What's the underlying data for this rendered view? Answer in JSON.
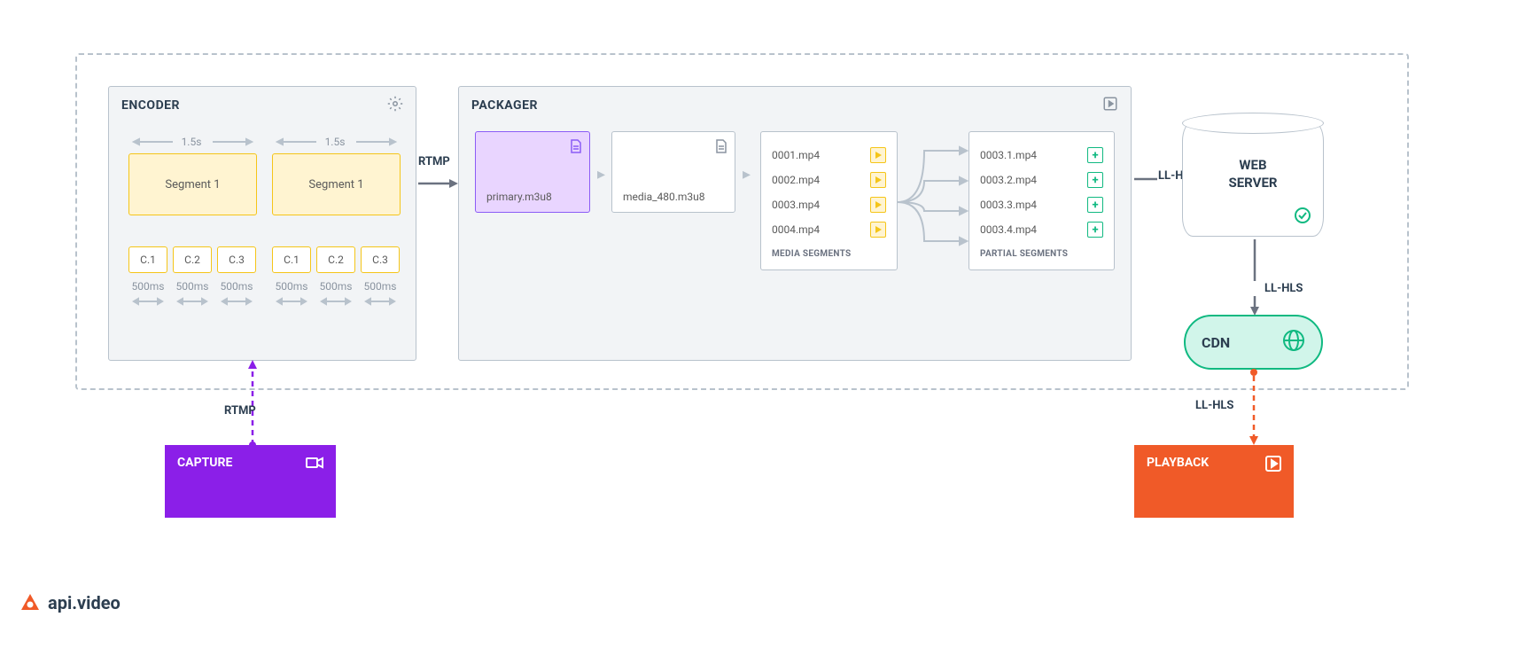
{
  "encoder": {
    "title": "ENCODER",
    "segment1": "Segment 1",
    "segment2": "Segment 1",
    "seg_time": "1.5s",
    "chunks": [
      "C.1",
      "C.2",
      "C.3"
    ],
    "chunk_time": "500ms"
  },
  "packager": {
    "title": "PACKAGER",
    "primary": "primary.m3u8",
    "media": "media_480.m3u8",
    "media_segments_label": "MEDIA SEGMENTS",
    "partial_segments_label": "PARTIAL SEGMENTS",
    "media_segments": [
      "0001.mp4",
      "0002.mp4",
      "0003.mp4",
      "0004.mp4"
    ],
    "partial_segments": [
      "0003.1.mp4",
      "0003.2.mp4",
      "0003.3.mp4",
      "0003.4.mp4"
    ]
  },
  "arrows": {
    "rtmp_capture": "RTMP",
    "rtmp_mid": "RTMP",
    "llhls1": "LL-HLS",
    "llhls2": "LL-HLS",
    "llhls3": "LL-HLS"
  },
  "webserver": {
    "line1": "WEB",
    "line2": "SERVER"
  },
  "cdn": {
    "label": "CDN"
  },
  "capture": {
    "label": "CAPTURE"
  },
  "playback": {
    "label": "PLAYBACK"
  },
  "brand": "api.video"
}
